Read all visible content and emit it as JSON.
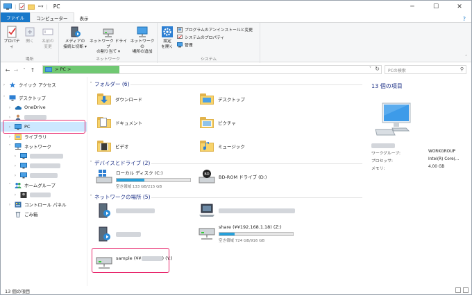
{
  "window": {
    "title": "PC",
    "min": "─",
    "max": "☐",
    "close": "✕"
  },
  "ribbon_tabs": {
    "file": "ファイル",
    "computer": "コンピューター",
    "view": "表示",
    "help": "?"
  },
  "ribbon": {
    "location": {
      "group": "場所",
      "properties": "プロパティ",
      "open": "開く",
      "rename": [
        "名前の",
        "変更"
      ]
    },
    "network": {
      "group": "ネットワーク",
      "media": [
        "メディアの",
        "接続と切断 ▾"
      ],
      "map_drive": [
        "ネットワーク ドライブ",
        "の割り当て ▾"
      ],
      "add_location": [
        "ネットワークの",
        "場所の追加"
      ]
    },
    "system": {
      "group": "システム",
      "settings": [
        "設定",
        "を開く"
      ],
      "uninstall": "プログラムのアンインストールと変更",
      "sysprops": "システムのプロパティ",
      "manage": "管理"
    }
  },
  "address": {
    "crumb": "PC",
    "search_placeholder": "PCの検索"
  },
  "nav": {
    "quick_access": "クイック アクセス",
    "desktop": "デスクトップ",
    "onedrive": "OneDrive",
    "pc": "PC",
    "libraries": "ライブラリ",
    "network": "ネットワーク",
    "homegroup": "ホームグループ",
    "control_panel": "コントロール パネル",
    "recycle_bin": "ごみ箱"
  },
  "sections": {
    "folders": "フォルダー (6)",
    "devices": "デバイスとドライブ (2)",
    "network": "ネットワークの場所 (5)"
  },
  "folders": [
    {
      "name": "ダウンロード"
    },
    {
      "name": "デスクトップ"
    },
    {
      "name": "ドキュメント"
    },
    {
      "name": "ピクチャ"
    },
    {
      "name": "ビデオ"
    },
    {
      "name": "ミュージック"
    }
  ],
  "drives": {
    "local": {
      "name": "ローカル ディスク (C:)",
      "space": "空き領域 133 GB/215 GB",
      "used": 0.38
    },
    "bd": {
      "name": "BD-ROM ドライブ (D:)"
    },
    "share": {
      "name": "share (¥¥192.168.1.18) (Z:)",
      "space": "空き領域 724 GB/916 GB",
      "used": 0.21
    },
    "sample": {
      "name": "sample (¥¥",
      "name_end": ") (Y:)"
    }
  },
  "details": {
    "count": "13 個の項目",
    "rows": [
      {
        "k": "ワークグループ:",
        "v": "WORKGROUP"
      },
      {
        "k": "プロセッサ:",
        "v": "Intel(R) Core(..."
      },
      {
        "k": "メモリ:",
        "v": "4.00 GB"
      }
    ]
  },
  "status": {
    "count": "13 個の項目"
  },
  "colors": {
    "accent": "#1979ca",
    "highlight": "#e8286d",
    "selection": "#cce8ff",
    "address_green": "#70c872"
  }
}
